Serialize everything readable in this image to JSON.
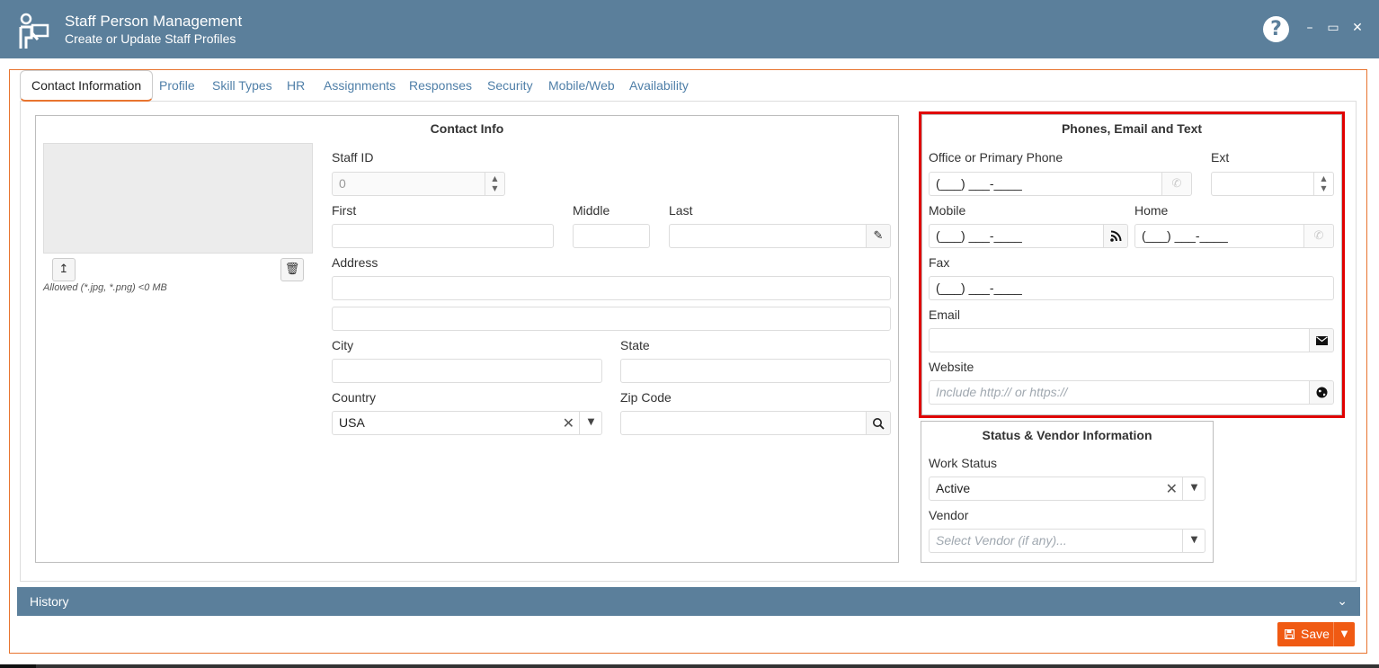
{
  "window": {
    "title": "Staff Person Management",
    "subtitle": "Create or Update Staff Profiles",
    "help_icon": "question-circle-icon",
    "minimize": "–",
    "maximize": "▭",
    "close": "✕"
  },
  "tabs": [
    {
      "label": "Contact Information",
      "active": true
    },
    {
      "label": "Profile"
    },
    {
      "label": "Skill Types"
    },
    {
      "label": "HR"
    },
    {
      "label": "Assignments"
    },
    {
      "label": "Responses"
    },
    {
      "label": "Security"
    },
    {
      "label": "Mobile/Web"
    },
    {
      "label": "Availability"
    }
  ],
  "contact_info": {
    "title": "Contact Info",
    "upload_icon": "↥",
    "delete_icon": "🗑",
    "allowed_note": "Allowed (*.jpg, *.png) <0 MB",
    "staff_id_label": "Staff ID",
    "staff_id_value": "0",
    "first_label": "First",
    "first_value": "",
    "middle_label": "Middle",
    "middle_value": "",
    "last_label": "Last",
    "last_value": "",
    "address_label": "Address",
    "address1_value": "",
    "address2_value": "",
    "city_label": "City",
    "city_value": "",
    "state_label": "State",
    "state_value": "",
    "country_label": "Country",
    "country_value": "USA",
    "zip_label": "Zip Code",
    "zip_value": ""
  },
  "phones": {
    "title": "Phones, Email and Text",
    "office_label": "Office or Primary Phone",
    "office_value": "(___) ___-____",
    "ext_label": "Ext",
    "ext_value": "",
    "mobile_label": "Mobile",
    "mobile_value": "(___) ___-____",
    "home_label": "Home",
    "home_value": "(___) ___-____",
    "fax_label": "Fax",
    "fax_value": "(___) ___-____",
    "email_label": "Email",
    "email_value": "",
    "website_label": "Website",
    "website_placeholder": "Include http:// or https://"
  },
  "status": {
    "title": "Status & Vendor Information",
    "work_status_label": "Work Status",
    "work_status_value": "Active",
    "vendor_label": "Vendor",
    "vendor_placeholder": "Select Vendor (if any)..."
  },
  "history": {
    "label": "History"
  },
  "save": {
    "label": "Save"
  },
  "colors": {
    "header": "#5b7f9b",
    "accent": "#e8742f",
    "save": "#f05a13",
    "highlight": "#e00000",
    "tab_link": "#4f7fa8"
  }
}
